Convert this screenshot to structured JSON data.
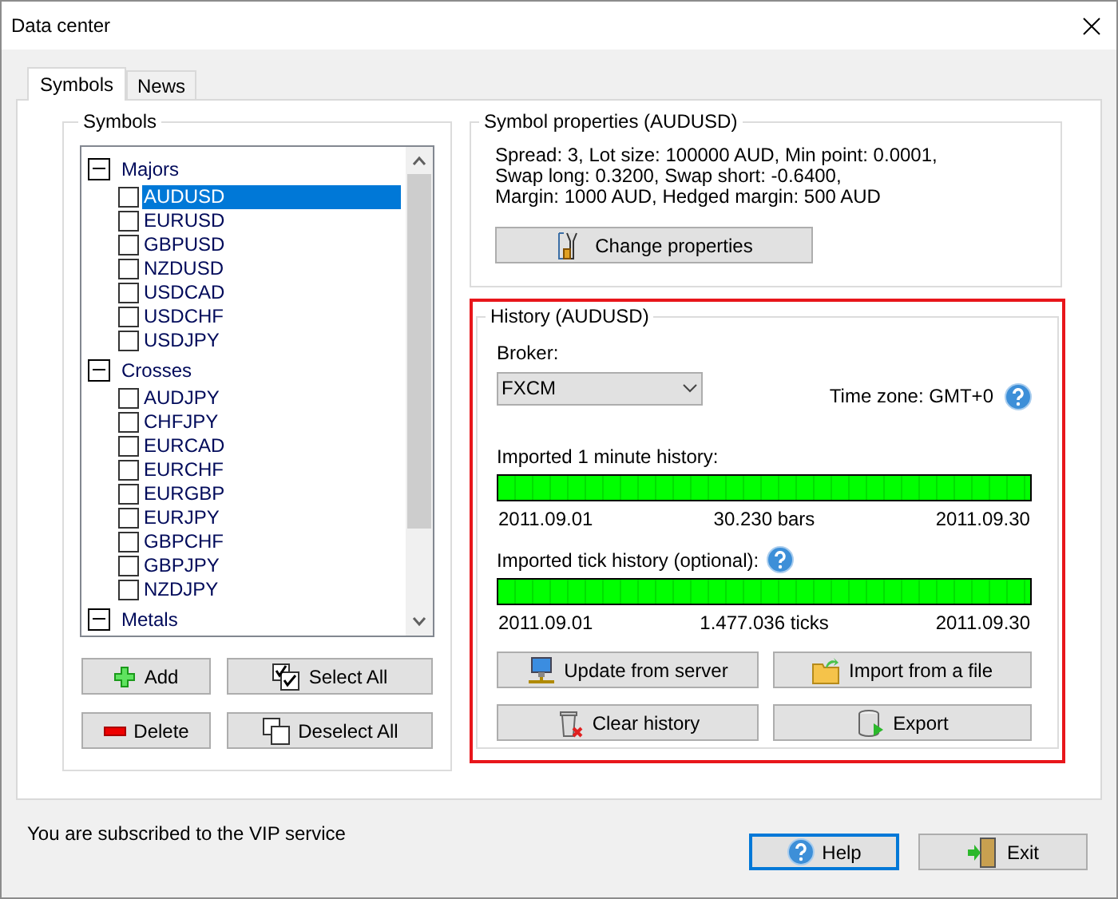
{
  "window": {
    "title": "Data center"
  },
  "tabs": [
    {
      "label": "Symbols",
      "selected": true
    },
    {
      "label": "News",
      "selected": false
    }
  ],
  "symbols_panel": {
    "title": "Symbols",
    "groups": [
      {
        "name": "Majors",
        "expanded": true,
        "children": [
          {
            "name": "AUDUSD",
            "checked": false,
            "selected": true
          },
          {
            "name": "EURUSD",
            "checked": false,
            "selected": false
          },
          {
            "name": "GBPUSD",
            "checked": false,
            "selected": false
          },
          {
            "name": "NZDUSD",
            "checked": false,
            "selected": false
          },
          {
            "name": "USDCAD",
            "checked": false,
            "selected": false
          },
          {
            "name": "USDCHF",
            "checked": false,
            "selected": false
          },
          {
            "name": "USDJPY",
            "checked": false,
            "selected": false
          }
        ]
      },
      {
        "name": "Crosses",
        "expanded": true,
        "children": [
          {
            "name": "AUDJPY",
            "checked": false,
            "selected": false
          },
          {
            "name": "CHFJPY",
            "checked": false,
            "selected": false
          },
          {
            "name": "EURCAD",
            "checked": false,
            "selected": false
          },
          {
            "name": "EURCHF",
            "checked": false,
            "selected": false
          },
          {
            "name": "EURGBP",
            "checked": false,
            "selected": false
          },
          {
            "name": "EURJPY",
            "checked": false,
            "selected": false
          },
          {
            "name": "GBPCHF",
            "checked": false,
            "selected": false
          },
          {
            "name": "GBPJPY",
            "checked": false,
            "selected": false
          },
          {
            "name": "NZDJPY",
            "checked": false,
            "selected": false
          }
        ]
      },
      {
        "name": "Metals",
        "expanded": true
      }
    ],
    "buttons": [
      {
        "label": "Add",
        "kind": "add"
      },
      {
        "label": "Select All",
        "kind": "select_all"
      },
      {
        "label": "Delete",
        "kind": "delete"
      },
      {
        "label": "Deselect All",
        "kind": "deselect_all"
      }
    ]
  },
  "properties": {
    "title": "Symbol properties (AUDUSD)",
    "lines": [
      "Spread: 3, Lot size: 100000 AUD, Min point: 0.0001,",
      "Swap long: 0.3200, Swap short: -0.6400,",
      "Margin: 1000 AUD, Hedged margin: 500 AUD"
    ],
    "button": "Change properties"
  },
  "history": {
    "title": "History (AUDUSD)",
    "highlighted": true,
    "broker_label": "Broker:",
    "broker": "FXCM",
    "timezone": "Time zone: GMT+0",
    "imports": [
      {
        "label": "Imported 1 minute history:",
        "help": false,
        "level": 1,
        "start": "2011.09.01",
        "count": "30.230 bars",
        "end": "2011.09.30"
      },
      {
        "label": "Imported tick history (optional):",
        "help": true,
        "level": 1,
        "start": "2011.09.01",
        "count": "1.477.036 ticks",
        "end": "2011.09.30"
      }
    ],
    "buttons": [
      {
        "label": "Update from server",
        "kind": "update"
      },
      {
        "label": "Import from a file",
        "kind": "import"
      },
      {
        "label": "Clear history",
        "kind": "clear"
      },
      {
        "label": "Export",
        "kind": "export"
      }
    ]
  },
  "footer": {
    "status": "You are subscribed to the VIP service",
    "buttons": [
      {
        "label": "Help",
        "kind": "help",
        "focused": true
      },
      {
        "label": "Exit",
        "kind": "exit",
        "focused": false
      }
    ]
  }
}
